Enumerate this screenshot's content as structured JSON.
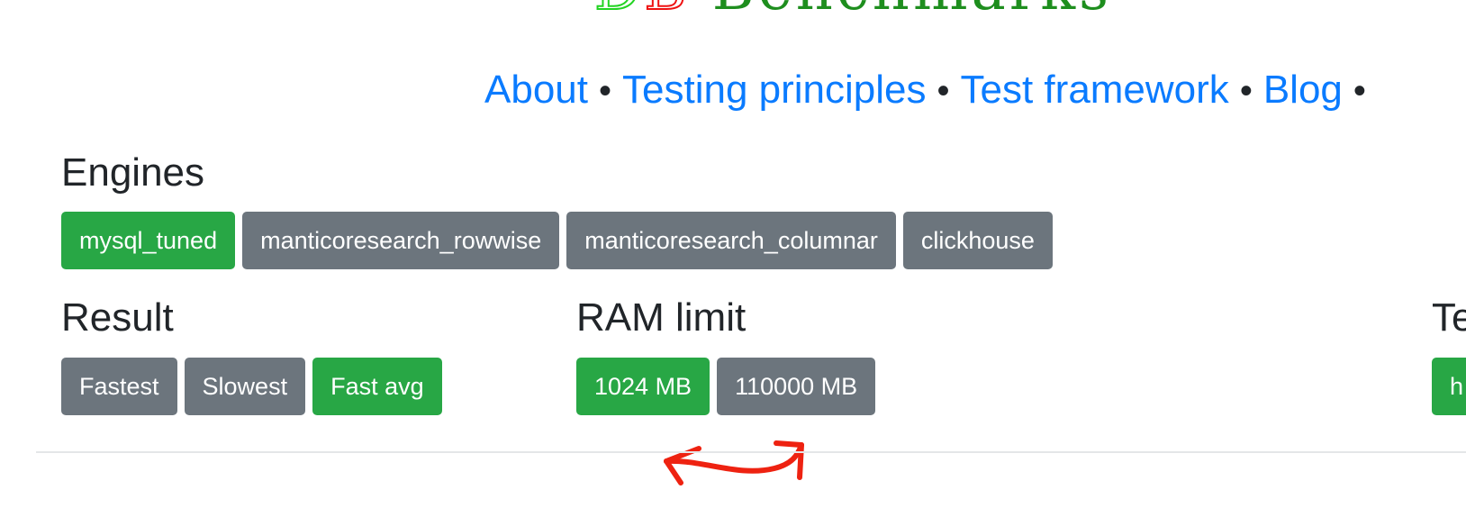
{
  "logo": {
    "part_green": "D",
    "part_red": "B",
    "rest": "Benchmarks"
  },
  "nav": {
    "items": [
      "About",
      "Testing principles",
      "Test framework",
      "Blog"
    ],
    "separator": "•"
  },
  "engines": {
    "title": "Engines",
    "buttons": [
      {
        "label": "mysql_tuned",
        "active": true
      },
      {
        "label": "manticoresearch_rowwise",
        "active": false
      },
      {
        "label": "manticoresearch_columnar",
        "active": false
      },
      {
        "label": "clickhouse",
        "active": false
      }
    ]
  },
  "result": {
    "title": "Result",
    "buttons": [
      {
        "label": "Fastest",
        "active": false
      },
      {
        "label": "Slowest",
        "active": false
      },
      {
        "label": "Fast avg",
        "active": true
      }
    ]
  },
  "ram_limit": {
    "title": "RAM limit",
    "buttons": [
      {
        "label": "1024 MB",
        "active": true
      },
      {
        "label": "110000 MB",
        "active": false
      }
    ]
  },
  "cut_section": {
    "title": "Te",
    "button_label": "h"
  },
  "colors": {
    "active": "#28a745",
    "inactive": "#6c757d",
    "link": "#0a7bff",
    "annotation": "#ee2211"
  }
}
